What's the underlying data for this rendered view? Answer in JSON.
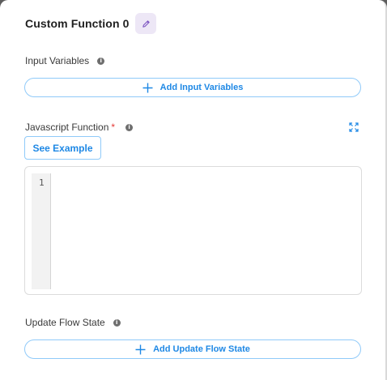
{
  "node": {
    "title": "Custom Function 0"
  },
  "input_variables": {
    "label": "Input Variables",
    "add_button_label": "Add Input Variables"
  },
  "javascript_function": {
    "label": "Javascript Function",
    "required_marker": "*",
    "see_example_label": "See Example",
    "editor": {
      "line_numbers": [
        "1"
      ],
      "code": ""
    }
  },
  "update_flow_state": {
    "label": "Update Flow State",
    "add_button_label": "Add Update Flow State"
  },
  "icons": {
    "edit": "pencil-icon",
    "info": "info-icon",
    "plus": "plus-icon",
    "expand": "expand-icon"
  },
  "colors": {
    "accent": "#1e88e5",
    "accent_border": "#90caf9",
    "edit_button_bg": "#ede7f6",
    "required": "#e53935"
  }
}
